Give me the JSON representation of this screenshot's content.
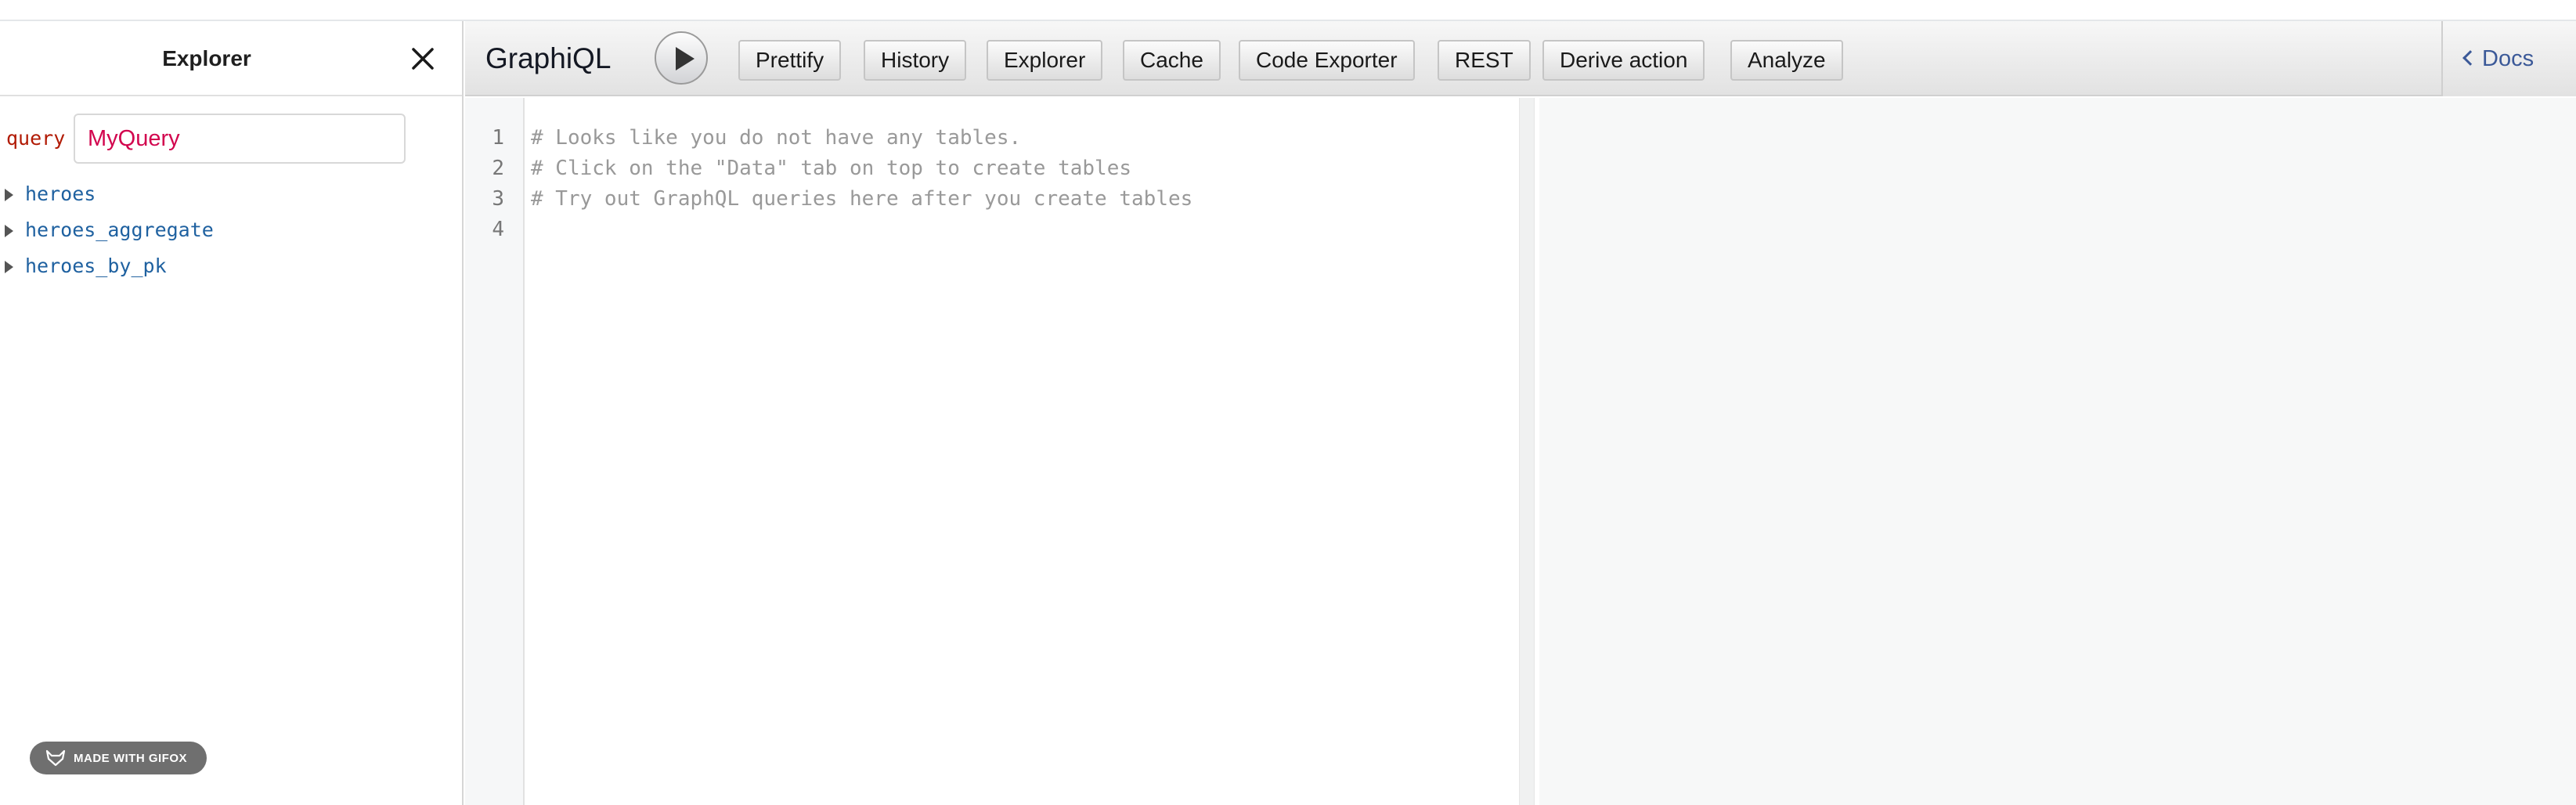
{
  "explorer": {
    "title": "Explorer",
    "query_keyword": "query",
    "query_name": "MyQuery",
    "fields": [
      "heroes",
      "heroes_aggregate",
      "heroes_by_pk"
    ],
    "watermark": "MADE WITH GIFOX"
  },
  "toolbar": {
    "title": "GraphiQL",
    "buttons": [
      "Prettify",
      "History",
      "Explorer",
      "Cache",
      "Code Exporter",
      "REST",
      "Derive action",
      "Analyze"
    ],
    "docs_label": "Docs"
  },
  "editor": {
    "line_numbers": [
      "1",
      "2",
      "3",
      "4"
    ],
    "lines": [
      "# Looks like you do not have any tables.",
      "# Click on the \"Data\" tab on top to create tables",
      "# Try out GraphQL queries here after you create tables",
      ""
    ]
  },
  "colors": {
    "keyword": "#b11a04",
    "query_name": "#d2054e",
    "field": "#1f61a0",
    "docs_link": "#3b5998",
    "comment": "#999999"
  }
}
